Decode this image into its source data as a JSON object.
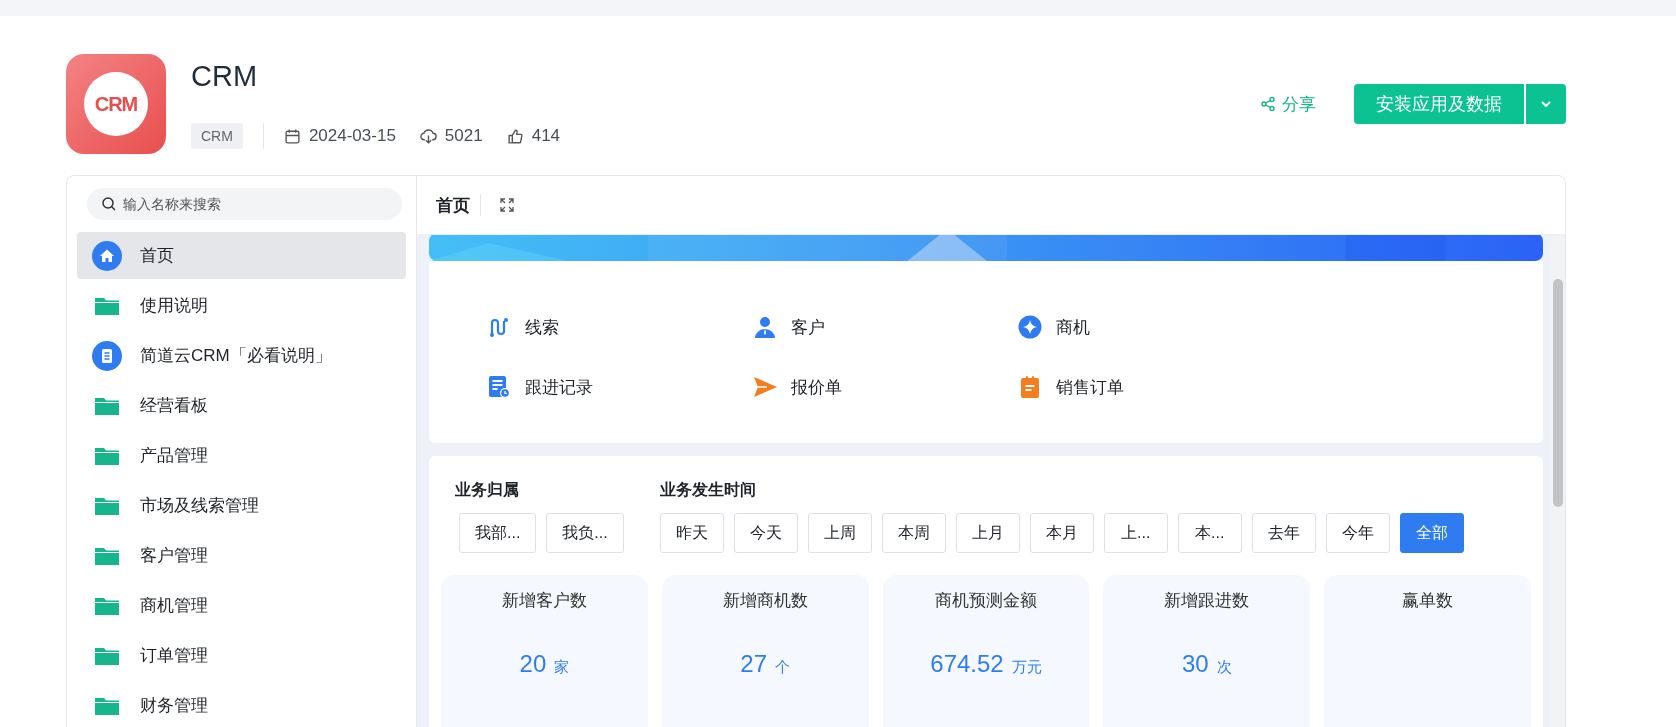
{
  "app": {
    "logo": "CRM",
    "title": "CRM",
    "tag": "CRM",
    "date": "2024-03-15",
    "downloads": "5021",
    "likes": "414"
  },
  "actions": {
    "share": "分享",
    "install": "安装应用及数据"
  },
  "sidebar": {
    "search_placeholder": "输入名称来搜索",
    "items": [
      {
        "label": "首页",
        "kind": "home",
        "selected": true
      },
      {
        "label": "使用说明",
        "kind": "folder",
        "selected": false
      },
      {
        "label": "简道云CRM「必看说明」",
        "kind": "doc",
        "selected": false
      },
      {
        "label": "经营看板",
        "kind": "folder",
        "selected": false
      },
      {
        "label": "产品管理",
        "kind": "folder",
        "selected": false
      },
      {
        "label": "市场及线索管理",
        "kind": "folder",
        "selected": false
      },
      {
        "label": "客户管理",
        "kind": "folder",
        "selected": false
      },
      {
        "label": "商机管理",
        "kind": "folder",
        "selected": false
      },
      {
        "label": "订单管理",
        "kind": "folder",
        "selected": false
      },
      {
        "label": "财务管理",
        "kind": "folder",
        "selected": false
      }
    ]
  },
  "tab": {
    "label": "首页"
  },
  "shortcuts": [
    {
      "label": "线索",
      "kind": "route"
    },
    {
      "label": "客户",
      "kind": "person"
    },
    {
      "label": "商机",
      "kind": "star"
    },
    {
      "label": "跟进记录",
      "kind": "record"
    },
    {
      "label": "报价单",
      "kind": "send"
    },
    {
      "label": "销售订单",
      "kind": "clipboard"
    }
  ],
  "filters": {
    "owner_label": "业务归属",
    "owner_options": [
      {
        "label": "我部...",
        "selected": false
      },
      {
        "label": "我负...",
        "selected": false
      }
    ],
    "time_label": "业务发生时间",
    "time_options": [
      {
        "label": "昨天",
        "selected": false
      },
      {
        "label": "今天",
        "selected": false
      },
      {
        "label": "上周",
        "selected": false
      },
      {
        "label": "本周",
        "selected": false
      },
      {
        "label": "上月",
        "selected": false
      },
      {
        "label": "本月",
        "selected": false
      },
      {
        "label": "上...",
        "selected": false
      },
      {
        "label": "本...",
        "selected": false
      },
      {
        "label": "去年",
        "selected": false
      },
      {
        "label": "今年",
        "selected": false
      },
      {
        "label": "全部",
        "selected": true
      }
    ]
  },
  "stats": [
    {
      "title": "新增客户数",
      "value": "20",
      "unit": "家"
    },
    {
      "title": "新增商机数",
      "value": "27",
      "unit": "个"
    },
    {
      "title": "商机预测金额",
      "value": "674.52",
      "unit": "万元"
    },
    {
      "title": "新增跟进数",
      "value": "30",
      "unit": "次"
    },
    {
      "title": "赢单数"
    }
  ]
}
